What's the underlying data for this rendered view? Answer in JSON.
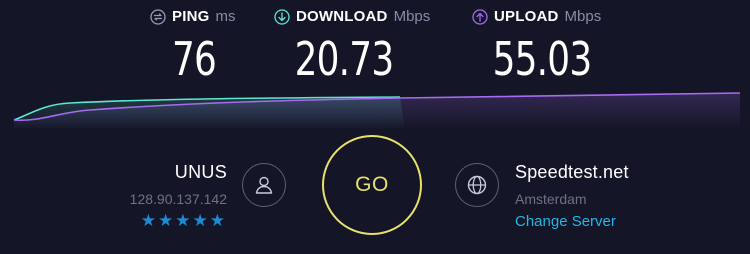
{
  "metrics": {
    "ping": {
      "label": "PING",
      "unit": "ms",
      "value": "76"
    },
    "download": {
      "label": "DOWNLOAD",
      "unit": "Mbps",
      "value": "20.73"
    },
    "upload": {
      "label": "UPLOAD",
      "unit": "Mbps",
      "value": "55.03"
    }
  },
  "isp": {
    "name": "UNUS",
    "ip": "128.90.137.142",
    "stars": "★★★★★"
  },
  "go_button": {
    "label": "GO"
  },
  "server": {
    "name": "Speedtest.net",
    "location": "Amsterdam",
    "change_label": "Change Server"
  },
  "colors": {
    "background": "#141526",
    "download": "#5ee6d0",
    "upload": "#a46cf0",
    "go": "#e8e26b",
    "link": "#1fb8e8",
    "stars": "#1f8ad1"
  },
  "icons": {
    "ping": "ping-icon",
    "download": "download-arrow-icon",
    "upload": "upload-arrow-icon",
    "user": "user-icon",
    "globe": "globe-icon"
  }
}
